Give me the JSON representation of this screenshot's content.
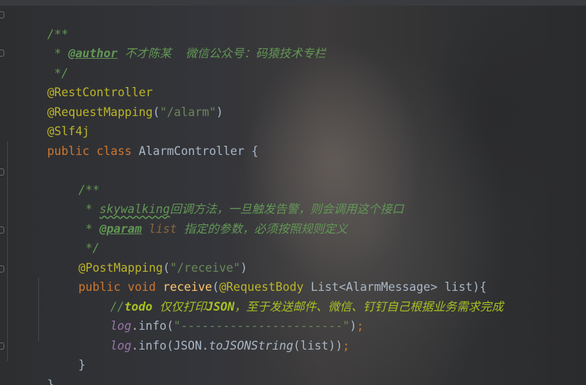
{
  "code": {
    "l1": "/**",
    "l2_star": " * ",
    "l2_tag": "@author",
    "l2_text": " 不才陈某  微信公众号：码猿技术专栏",
    "l3": " */",
    "l4": "@RestController",
    "l5_ann": "@RequestMapping",
    "l5_open": "(",
    "l5_str": "\"/alarm\"",
    "l5_close": ")",
    "l6": "@Slf4j",
    "l7_kw1": "public ",
    "l7_kw2": "class ",
    "l7_name": "AlarmController {",
    "l9": "/**",
    "l10_star": " * ",
    "l10_word": "skywalking",
    "l10_text": "回调方法，一旦触发告警，则会调用这个接口",
    "l11_star": " * ",
    "l11_tag": "@param",
    "l11_param": " list",
    "l11_text": " 指定的参数，必须按照规则定义",
    "l12": " */",
    "l13_ann": "@PostMapping",
    "l13_open": "(",
    "l13_str": "\"/receive\"",
    "l13_close": ")",
    "l14_kw1": "public ",
    "l14_kw2": "void ",
    "l14_fn": "receive",
    "l14_open": "(",
    "l14_ann": "@RequestBody",
    "l14_rest": " List<AlarmMessage> list){",
    "l15_slash": "//",
    "l15_todo": "todo",
    "l15_mid": " 仅仅打印",
    "l15_json": "JSON",
    "l15_rest": "，至于发送邮件、微信、钉钉自己根据业务需求完成",
    "l16_log": "log",
    "l16_call": ".info(",
    "l16_str": "\"-----------------------\"",
    "l16_close": ")",
    "l16_semi": ";",
    "l17_log": "log",
    "l17_call": ".info(JSON.",
    "l17_method": "toJSONString",
    "l17_close": "(list))",
    "l17_semi": ";",
    "l19": "}",
    "l20": "}"
  },
  "colors": {
    "background": "#2b2b2b",
    "keyword": "#cc7832",
    "annotation": "#bbb529",
    "string": "#6a8759",
    "doc_comment": "#629755",
    "method": "#ffc66d",
    "field": "#9876aa",
    "todo": "#a8c023"
  }
}
